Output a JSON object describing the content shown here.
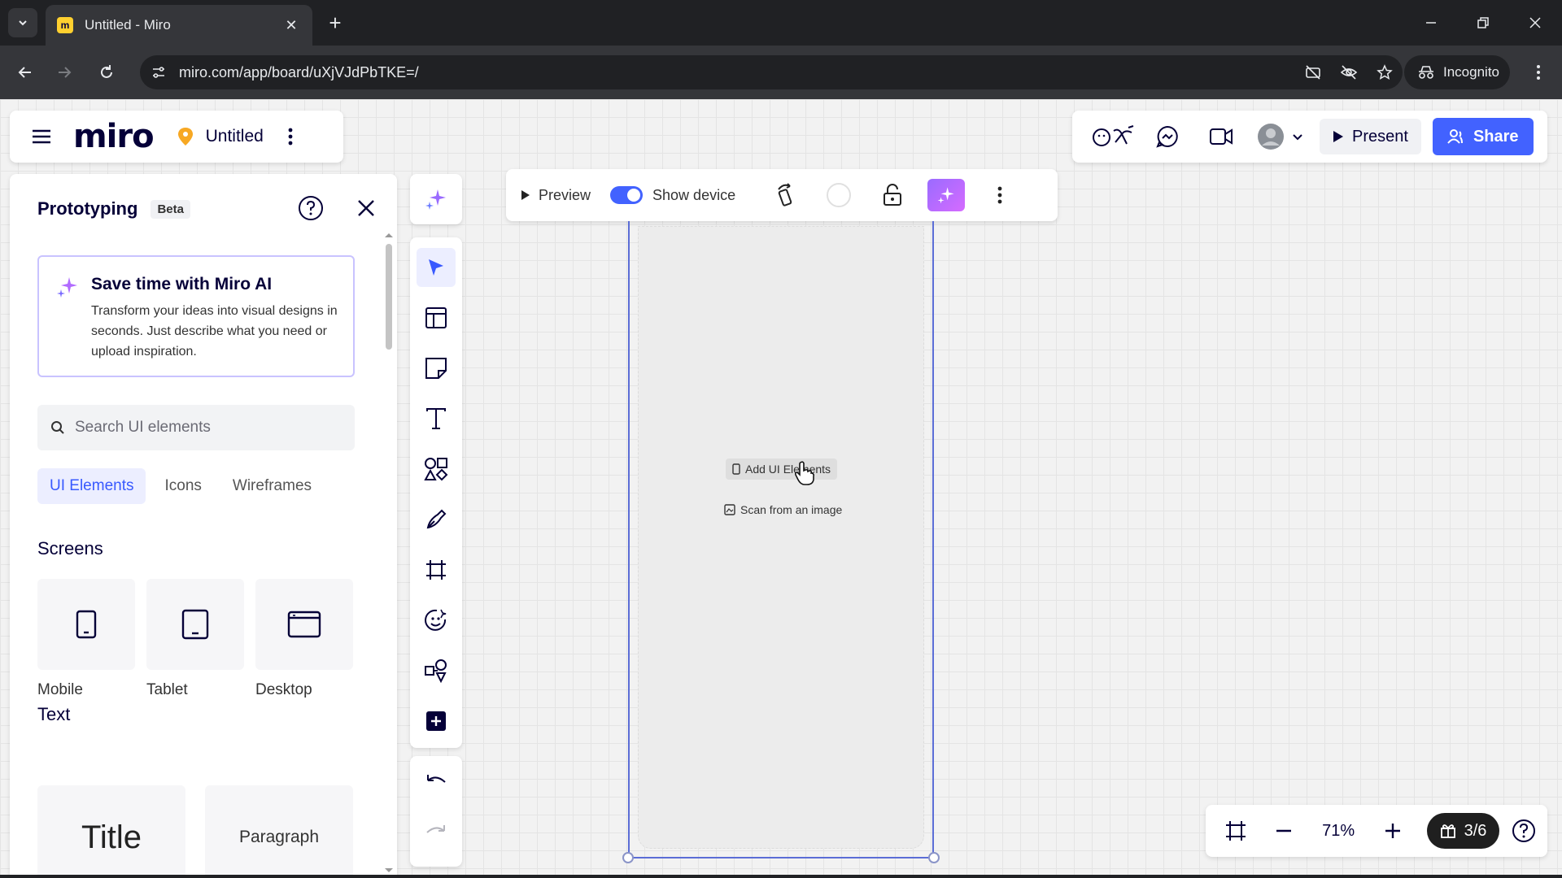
{
  "browser": {
    "tab_title": "Untitled - Miro",
    "tab_favicon_letter": "m",
    "url": "miro.com/app/board/uXjVJdPbTKE=/",
    "incognito_label": "Incognito"
  },
  "board": {
    "logo": "miro",
    "title": "Untitled",
    "present_label": "Present",
    "share_label": "Share"
  },
  "panel": {
    "title": "Prototyping",
    "badge": "Beta",
    "ai_title": "Save time with Miro AI",
    "ai_text": "Transform your ideas into visual designs in seconds. Just describe what you need or upload inspiration.",
    "search_placeholder": "Search UI elements",
    "tabs": [
      "UI Elements",
      "Icons",
      "Wireframes"
    ],
    "screens_title": "Screens",
    "screens": [
      "Mobile",
      "Tablet",
      "Desktop"
    ],
    "text_title": "Text",
    "text_items": [
      "Title",
      "Paragraph"
    ]
  },
  "frame_toolbar": {
    "preview_label": "Preview",
    "show_device_label": "Show device",
    "show_device_on": true
  },
  "device": {
    "add_ui_label": "Add UI Elements",
    "scan_label": "Scan from an image"
  },
  "bottom": {
    "zoom": "71%",
    "pages": "3/6"
  },
  "colors": {
    "accent": "#4262ff",
    "favicon": "#ffd02f",
    "board_pin": "#f7a823",
    "ai_gradient_start": "#9a6bff",
    "ai_gradient_end": "#d56bff"
  }
}
